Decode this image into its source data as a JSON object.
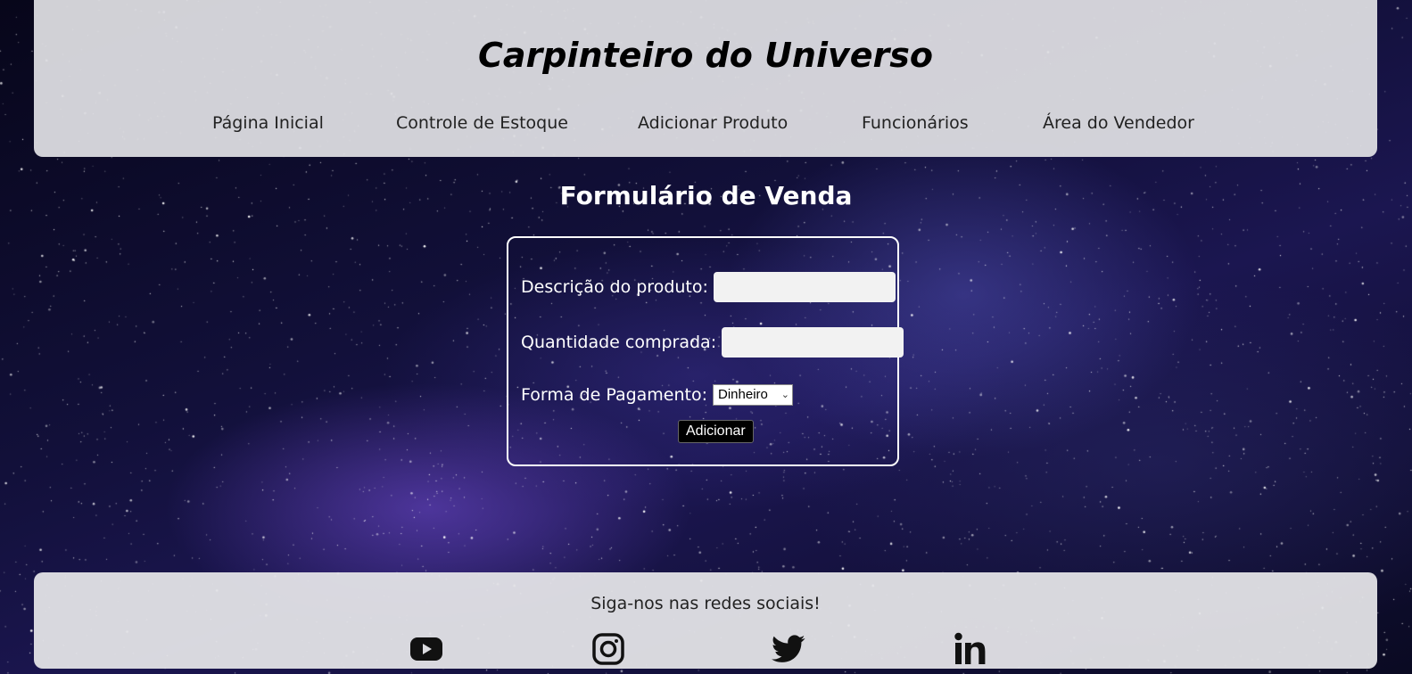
{
  "header": {
    "title": "Carpinteiro do Universo",
    "nav": [
      {
        "label": "Página Inicial"
      },
      {
        "label": "Controle de Estoque"
      },
      {
        "label": "Adicionar Produto"
      },
      {
        "label": "Funcionários"
      },
      {
        "label": "Área do Vendedor"
      }
    ]
  },
  "form": {
    "title": "Formulário de Venda",
    "description_label": "Descrição do produto:",
    "description_value": "",
    "quantity_label": "Quantidade comprada:",
    "quantity_value": "",
    "payment_label": "Forma de Pagamento:",
    "payment_selected": "Dinheiro",
    "submit_label": "Adicionar"
  },
  "footer": {
    "text": "Siga-nos nas redes sociais!",
    "social_icons": [
      "youtube-icon",
      "instagram-icon",
      "twitter-icon",
      "linkedin-icon"
    ]
  },
  "colors": {
    "panel_background": "#dedee2",
    "text_dark": "#000000",
    "form_text": "#ffffff",
    "button_background": "#000000"
  }
}
